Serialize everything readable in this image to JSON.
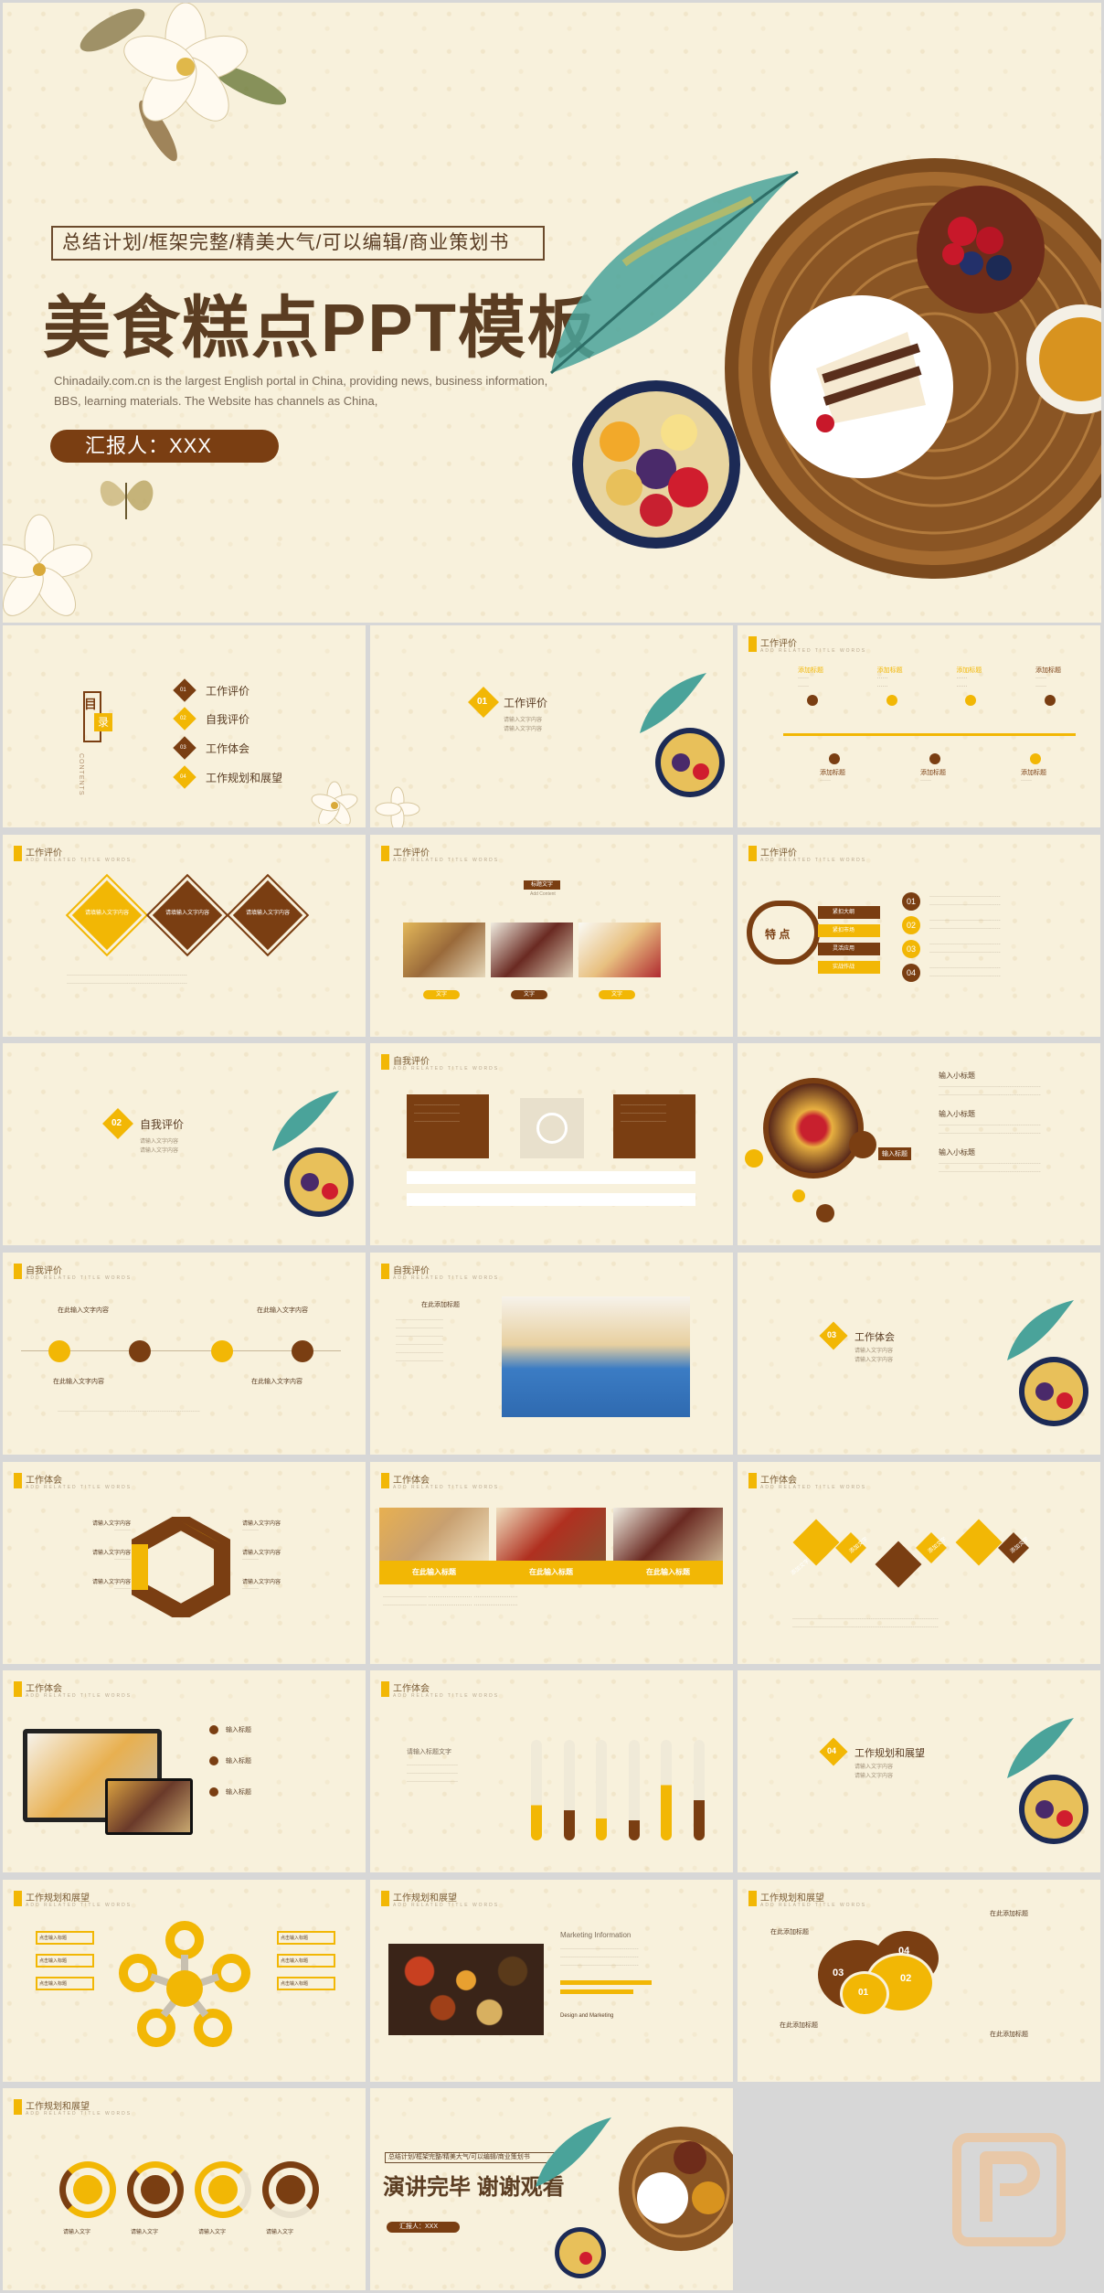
{
  "hero": {
    "tagline": "总结计划/框架完整/精美大气/可以编辑/商业策划书",
    "title": "美食糕点PPT模板",
    "desc": "Chinadaily.com.cn is the largest English portal in China, providing news, business information, BBS, learning materials. The Website has channels as China,",
    "reporter": "汇报人：XXX"
  },
  "toc": {
    "label_mu": "目",
    "label_lu": "录",
    "contents": "CONTENTS",
    "items": [
      {
        "num": "01",
        "text": "工作评价"
      },
      {
        "num": "02",
        "text": "自我评价"
      },
      {
        "num": "03",
        "text": "工作体会"
      },
      {
        "num": "04",
        "text": "工作规划和展望"
      }
    ]
  },
  "sections": {
    "s1": {
      "num": "01",
      "title": "工作评价"
    },
    "s2": {
      "num": "02",
      "title": "自我评价"
    },
    "s3": {
      "num": "03",
      "title": "工作体会"
    },
    "s4": {
      "num": "04",
      "title": "工作规划和展望"
    },
    "line1": "请输入文字内容",
    "line2": "请输入文字内容"
  },
  "slide_titles": {
    "work_eval": "工作评价",
    "self_eval": "自我评价",
    "work_exp": "工作体会",
    "plan": "工作规划和展望",
    "sub": "ADD RELATED TITLE WORDS"
  },
  "timeline": {
    "top": [
      "添加标题",
      "添加标题",
      "添加标题",
      "添加标题"
    ],
    "bottom": [
      "添加标题",
      "添加标题",
      "添加标题"
    ]
  },
  "diamonds": [
    "请填输入文字内容",
    "请填输入文字内容",
    "请填输入文字内容"
  ],
  "photo_slide": {
    "header": "标题文字",
    "sub": "Add Content",
    "btns": [
      "文字",
      "文字",
      "文字"
    ]
  },
  "features": {
    "center": "特 点",
    "items": [
      "紧扣大纲",
      "紧扣市场",
      "灵活应用",
      "实战作战"
    ],
    "nums": [
      "01",
      "02",
      "03",
      "04"
    ]
  },
  "circle_slide": {
    "center": "输入标题",
    "items": [
      "输入小标题",
      "输入小标题",
      "输入小标题"
    ]
  },
  "icons_slide": {
    "labels": [
      "在此输入文字内容",
      "在此输入文字内容",
      "在此输入文字内容",
      "在此输入文字内容"
    ]
  },
  "cake_slide": {
    "header": "在此添加标题"
  },
  "hexagon_slide": {
    "left": [
      "请输入文字内容",
      "请输入文字内容",
      "请输入文字内容"
    ],
    "right": [
      "请输入文字内容",
      "请输入文字内容",
      "请输入文字内容"
    ]
  },
  "three_photos": {
    "labels": [
      "在此输入标题",
      "在此输入标题",
      "在此输入标题"
    ]
  },
  "diamond_icons": {
    "labels": [
      "添加文字",
      "添加文字",
      "添加文字",
      "添加文字"
    ]
  },
  "monitor_slide": {
    "items": [
      "输入标题",
      "输入标题",
      "输入标题"
    ]
  },
  "bars_slide": {
    "header": "请输入标题文字"
  },
  "flower_slide": {
    "items": [
      "点击输入标题",
      "点击输入标题",
      "点击输入标题",
      "点击输入标题",
      "点击输入标题",
      "点击输入标题"
    ]
  },
  "spice_slide": {
    "header": "Marketing Information",
    "bottom": "Design and Marketing"
  },
  "bubble_slide": {
    "top": "在此添加标题",
    "bottom": "在此添加标题",
    "nums": [
      "03",
      "01",
      "02",
      "04"
    ],
    "right": [
      "在此添加标题",
      "在此添加标题"
    ]
  },
  "rings_slide": {
    "labels": [
      "请输入文字",
      "请输入文字",
      "请输入文字",
      "请输入文字"
    ]
  },
  "end": {
    "tagline": "总结计划/框架完整/精美大气/可以编辑/商业策划书",
    "title": "演讲完毕  谢谢观看",
    "reporter": "汇报人：XXX"
  },
  "colors": {
    "brown": "#7a3e12",
    "yellow": "#f2b705",
    "paper": "#f8f1dc"
  }
}
